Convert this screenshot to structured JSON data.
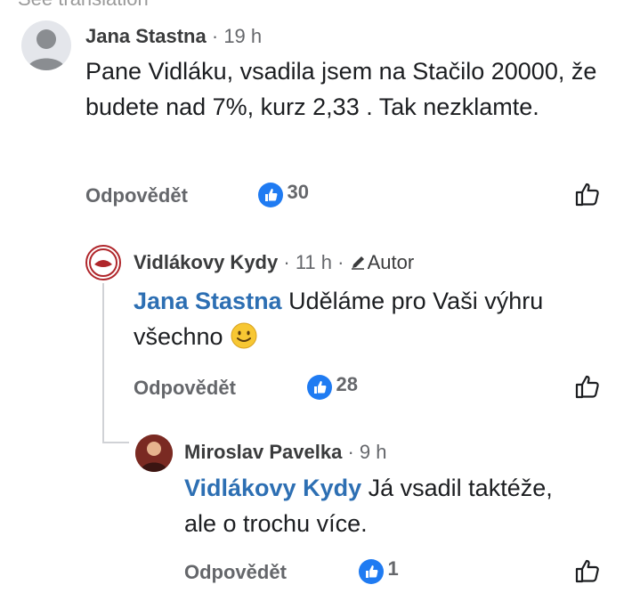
{
  "header": {
    "translation_link": "See translation"
  },
  "comments": [
    {
      "author": "Jana Stastna",
      "time": "19 h",
      "text": "Pane Vidláku, vsadila jsem na Stačilo 20000, že budete nad 7%, kurz 2,33 . Tak nezklamte.",
      "reply_label": "Odpovědět",
      "like_count": "30"
    },
    {
      "author": "Vidlákovy Kydy",
      "time": "11 h",
      "badge": "Autor",
      "mention": "Jana Stastna",
      "text": "Uděláme pro Vaši výhru všechno",
      "emoji": "smiling-face",
      "reply_label": "Odpovědět",
      "like_count": "28"
    },
    {
      "author": "Miroslav Pavelka",
      "time": "9 h",
      "mention": "Vidlákovy Kydy",
      "text": "Já vsadil taktéže, ale o trochu více.",
      "reply_label": "Odpovědět",
      "like_count": "1"
    }
  ],
  "separator": "·",
  "colors": {
    "like_blue": "#1f7bf2",
    "mention_blue": "#2d6fb3",
    "muted": "#65676b"
  }
}
